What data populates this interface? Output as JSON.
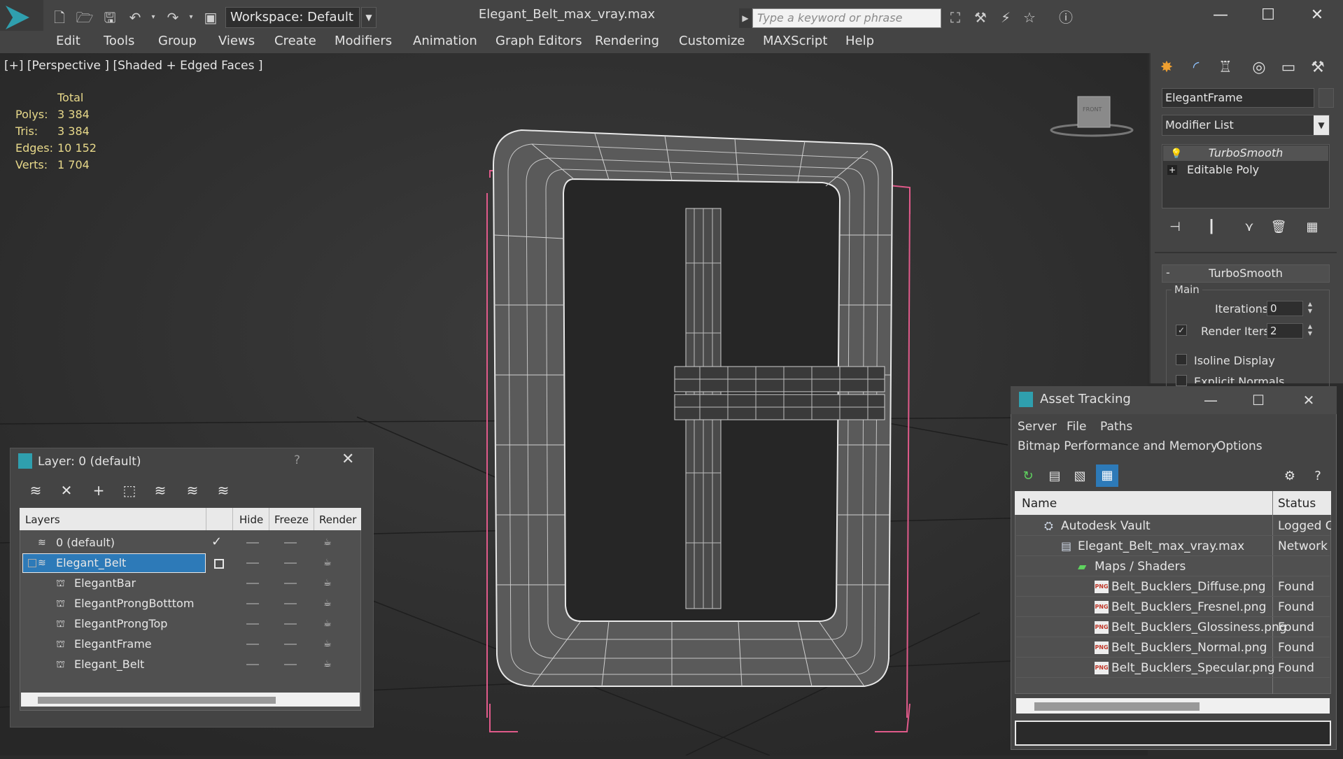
{
  "window": {
    "file_title": "Elegant_Belt_max_vray.max",
    "workspace": "Workspace: Default",
    "search_placeholder": "Type a keyword or phrase",
    "minimize": "—",
    "maximize": "☐",
    "close": "✕"
  },
  "menu": [
    "Edit",
    "Tools",
    "Group",
    "Views",
    "Create",
    "Modifiers",
    "Animation",
    "Graph Editors",
    "Rendering",
    "Customize",
    "MAXScript",
    "Help"
  ],
  "viewport": {
    "label": "[+] [Perspective ] [Shaded + Edged Faces ]",
    "viewcube_face": "FRONT",
    "stats": {
      "header": "Total",
      "rows": [
        {
          "label": "Polys:",
          "value": "3 384"
        },
        {
          "label": "Tris:",
          "value": "3 384"
        },
        {
          "label": "Edges:",
          "value": "10 152"
        },
        {
          "label": "Verts:",
          "value": "1 704"
        }
      ]
    }
  },
  "command_panel": {
    "object_name": "ElegantFrame",
    "modifier_list": "Modifier List",
    "stack": [
      "TurboSmooth",
      "Editable Poly"
    ],
    "rollout_title": "TurboSmooth",
    "rollout_minus": "-",
    "group_main": "Main",
    "iterations_label": "Iterations:",
    "iterations_value": "0",
    "render_iters_label": "Render Iters:",
    "render_iters_value": "2",
    "render_iters_checked": "✓",
    "isoline_label": "Isoline Display",
    "explicit_normals_label": "Explicit Normals"
  },
  "layer_window": {
    "title": "Layer: 0 (default)",
    "help": "?",
    "close": "✕",
    "columns": {
      "layers": "Layers",
      "hide": "Hide",
      "freeze": "Freeze",
      "render": "Render"
    },
    "rows": [
      {
        "name": "0 (default)",
        "level": 0,
        "active_mark": "✓",
        "selected": false
      },
      {
        "name": "Elegant_Belt",
        "level": 0,
        "active_mark": "",
        "selected": true
      },
      {
        "name": "ElegantBar",
        "level": 1,
        "active_mark": "",
        "selected": false
      },
      {
        "name": "ElegantProngBotttom",
        "level": 1,
        "active_mark": "",
        "selected": false
      },
      {
        "name": "ElegantProngTop",
        "level": 1,
        "active_mark": "",
        "selected": false
      },
      {
        "name": "ElegantFrame",
        "level": 1,
        "active_mark": "",
        "selected": false
      },
      {
        "name": "Elegant_Belt",
        "level": 1,
        "active_mark": "",
        "selected": false
      }
    ]
  },
  "asset_window": {
    "title": "Asset Tracking",
    "minimize": "—",
    "maximize": "☐",
    "close": "✕",
    "menu_row1": [
      "Server",
      "File",
      "Paths"
    ],
    "menu_row2": [
      "Bitmap Performance and Memory",
      "Options"
    ],
    "columns": {
      "name": "Name",
      "status": "Status"
    },
    "rows": [
      {
        "name": "Autodesk Vault",
        "status": "Logged C",
        "level": 0,
        "icon": "vault-icon"
      },
      {
        "name": "Elegant_Belt_max_vray.max",
        "status": "Network",
        "level": 1,
        "icon": "max-file-icon"
      },
      {
        "name": "Maps / Shaders",
        "status": "",
        "level": 2,
        "icon": "maps-icon"
      },
      {
        "name": "Belt_Bucklers_Diffuse.png",
        "status": "Found",
        "level": 3,
        "icon": "png-icon"
      },
      {
        "name": "Belt_Bucklers_Fresnel.png",
        "status": "Found",
        "level": 3,
        "icon": "png-icon"
      },
      {
        "name": "Belt_Bucklers_Glossiness.png",
        "status": "Found",
        "level": 3,
        "icon": "png-icon"
      },
      {
        "name": "Belt_Bucklers_Normal.png",
        "status": "Found",
        "level": 3,
        "icon": "png-icon"
      },
      {
        "name": "Belt_Bucklers_Specular.png",
        "status": "Found",
        "level": 3,
        "icon": "png-icon"
      }
    ]
  },
  "colors": {
    "accent": "#2f9fae",
    "selection": "#2d7ab8",
    "stats_text": "#e8d98a",
    "bbox_pink": "#e05a8a"
  }
}
